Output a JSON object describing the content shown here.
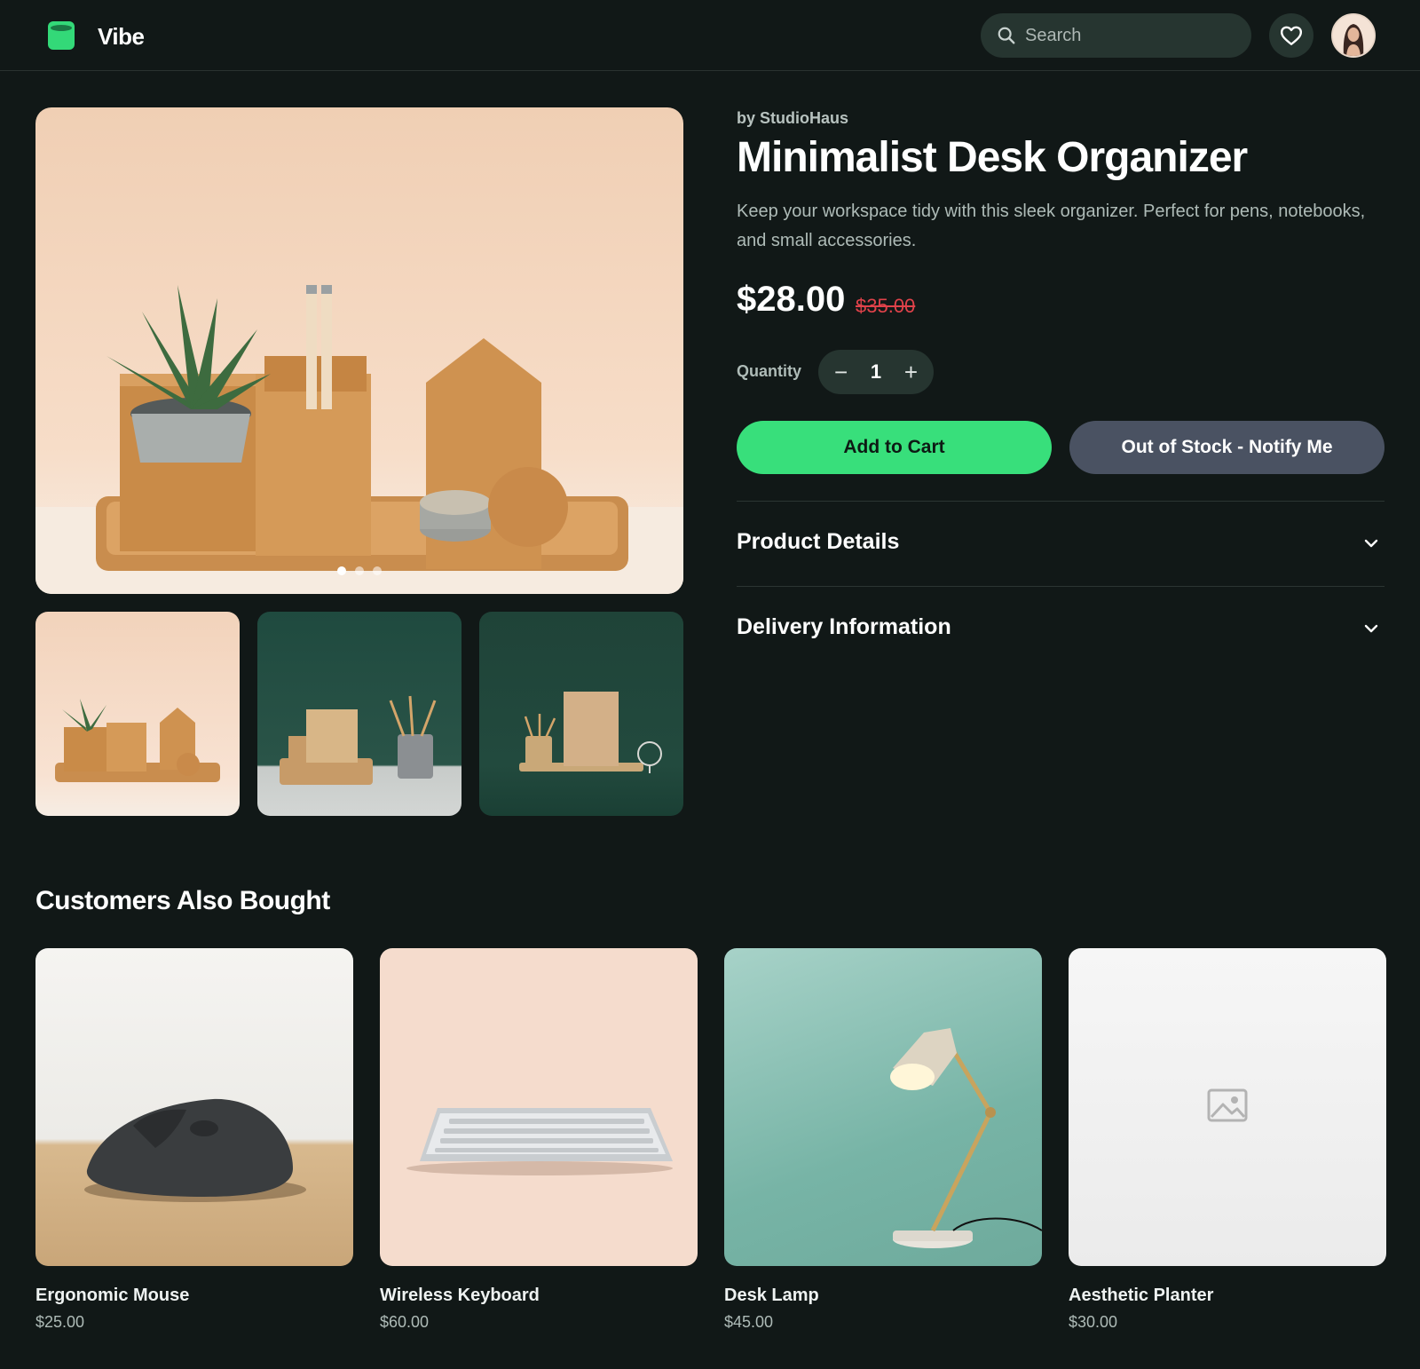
{
  "header": {
    "app_name": "Vibe",
    "search_placeholder": "Search"
  },
  "gallery": {
    "active_index": 0,
    "image_count": 3
  },
  "product": {
    "brand": "by StudioHaus",
    "title": "Minimalist Desk Organizer",
    "description": "Keep your workspace tidy with this sleek organizer. Perfect for pens, notebooks, and small accessories.",
    "price": "$28.00",
    "original_price": "$35.00",
    "quantity_label": "Quantity",
    "quantity": "1",
    "decrement_symbol": "−",
    "increment_symbol": "+",
    "add_to_cart_label": "Add to Cart",
    "notify_label": "Out of Stock - Notify Me"
  },
  "accordions": [
    {
      "title": "Product Details"
    },
    {
      "title": "Delivery Information"
    }
  ],
  "also_bought": {
    "title": "Customers Also Bought",
    "items": [
      {
        "name": "Ergonomic Mouse",
        "price": "$25.00"
      },
      {
        "name": "Wireless Keyboard",
        "price": "$60.00"
      },
      {
        "name": "Desk Lamp",
        "price": "$45.00"
      },
      {
        "name": "Aesthetic Planter",
        "price": "$30.00"
      }
    ]
  },
  "colors": {
    "background": "#111817",
    "accent_green": "#38df7b",
    "notify_button": "#4a5262",
    "strike_price": "#e0424a"
  }
}
